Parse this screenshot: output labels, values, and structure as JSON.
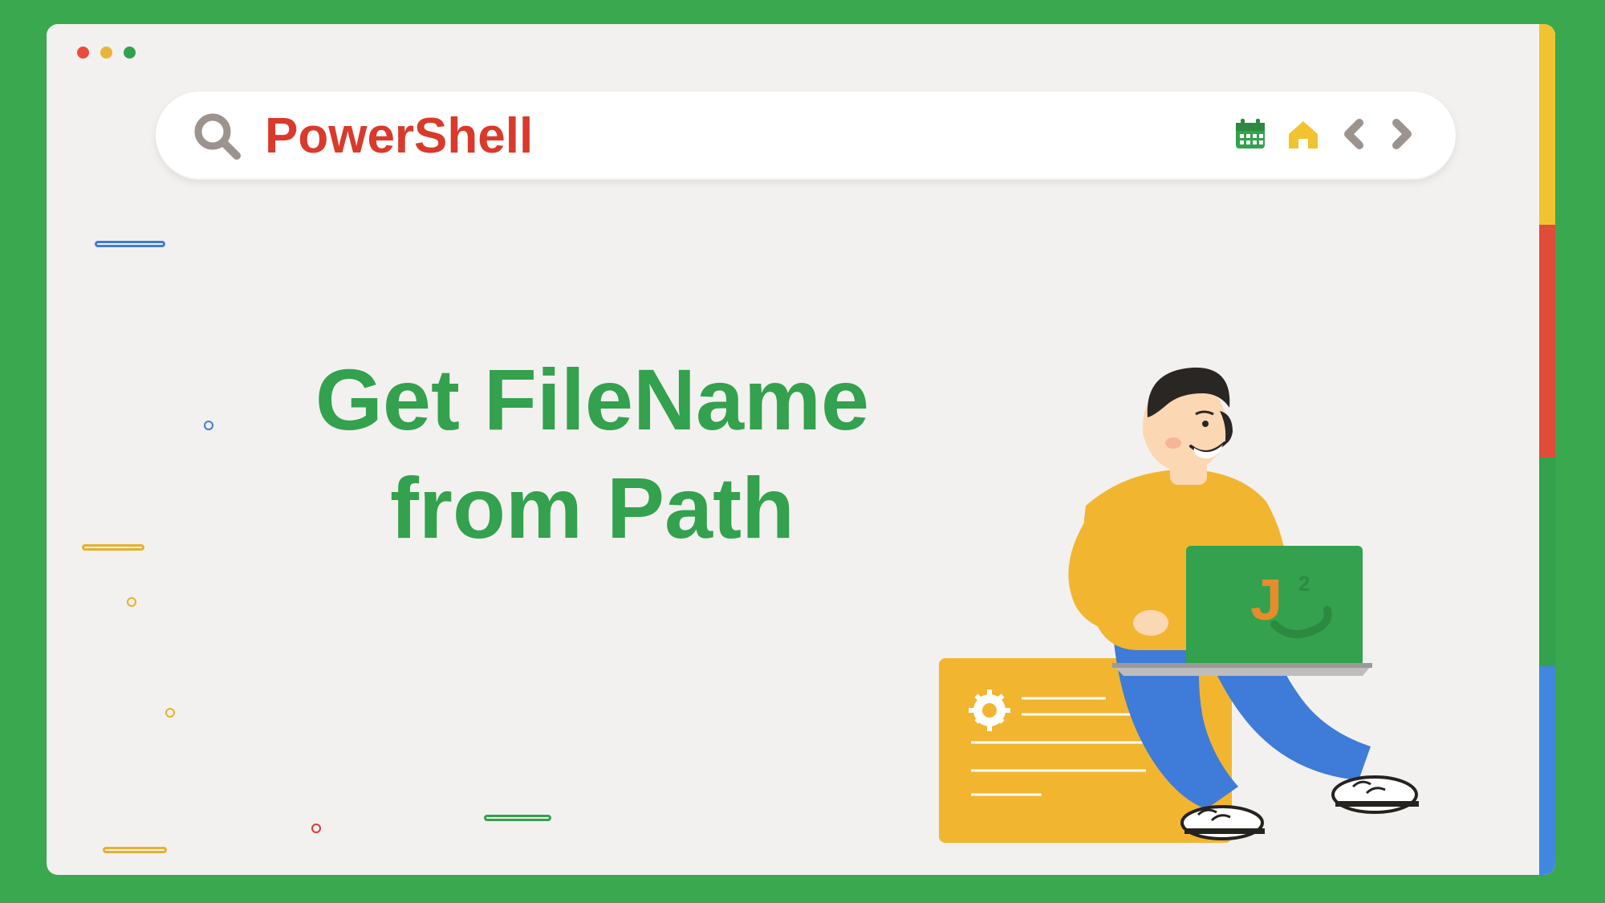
{
  "header": {
    "search_title": "PowerShell",
    "icons": {
      "search": "search-icon",
      "calendar": "calendar-icon",
      "home": "home-icon",
      "back": "chevron-left-icon",
      "forward": "chevron-right-icon"
    }
  },
  "main": {
    "title_line1": "Get FileName",
    "title_line2": "from Path"
  },
  "illustration": {
    "laptop_logo_text": "J",
    "laptop_logo_badge": "2"
  },
  "colors": {
    "accent_green": "#33a14d",
    "accent_red": "#d93a2b",
    "accent_yellow": "#f2c331",
    "accent_blue": "#4186e0",
    "bg_page": "#39a84f",
    "bg_window": "#f2f1ef"
  }
}
